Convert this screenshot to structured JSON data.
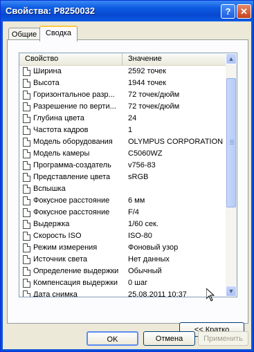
{
  "window": {
    "title": "Свойства: P8250032"
  },
  "tabs": [
    {
      "label": "Общие"
    },
    {
      "label": "Сводка"
    }
  ],
  "list": {
    "columns": [
      "Свойство",
      "Значение"
    ],
    "rows": [
      {
        "prop": "Ширина",
        "value": "2592 точек"
      },
      {
        "prop": "Высота",
        "value": "1944 точек"
      },
      {
        "prop": "Горизонтальное разр...",
        "value": "72 точек/дюйм"
      },
      {
        "prop": "Разрешение по верти...",
        "value": "72 точек/дюйм"
      },
      {
        "prop": "Глубина цвета",
        "value": "24"
      },
      {
        "prop": "Частота кадров",
        "value": "1"
      },
      {
        "prop": "Модель оборудования",
        "value": "OLYMPUS CORPORATION"
      },
      {
        "prop": "Модель камеры",
        "value": "C5060WZ"
      },
      {
        "prop": "Программа-создатель",
        "value": "v756-83"
      },
      {
        "prop": "Представление цвета",
        "value": "sRGB"
      },
      {
        "prop": "Вспышка",
        "value": ""
      },
      {
        "prop": "Фокусное расстояние",
        "value": "6 мм"
      },
      {
        "prop": "Фокусное расстояние",
        "value": "F/4"
      },
      {
        "prop": "Выдержка",
        "value": "1/60 сек."
      },
      {
        "prop": "Скорость ISO",
        "value": "ISO-80"
      },
      {
        "prop": "Режим измерения",
        "value": "Фоновый узор"
      },
      {
        "prop": "Источник света",
        "value": "Нет данных"
      },
      {
        "prop": "Определение выдержки",
        "value": "Обычный"
      },
      {
        "prop": "Компенсация выдержки",
        "value": "0 шаг"
      },
      {
        "prop": "Дата снимка",
        "value": "25.08.2011 10:37"
      }
    ]
  },
  "buttons": {
    "brief": "<< Кратко",
    "ok": "OK",
    "cancel": "Отмена",
    "apply": "Применить"
  },
  "icons": {
    "help": "?",
    "close": "✕",
    "scroll_up": "▲",
    "scroll_down": "▼"
  }
}
